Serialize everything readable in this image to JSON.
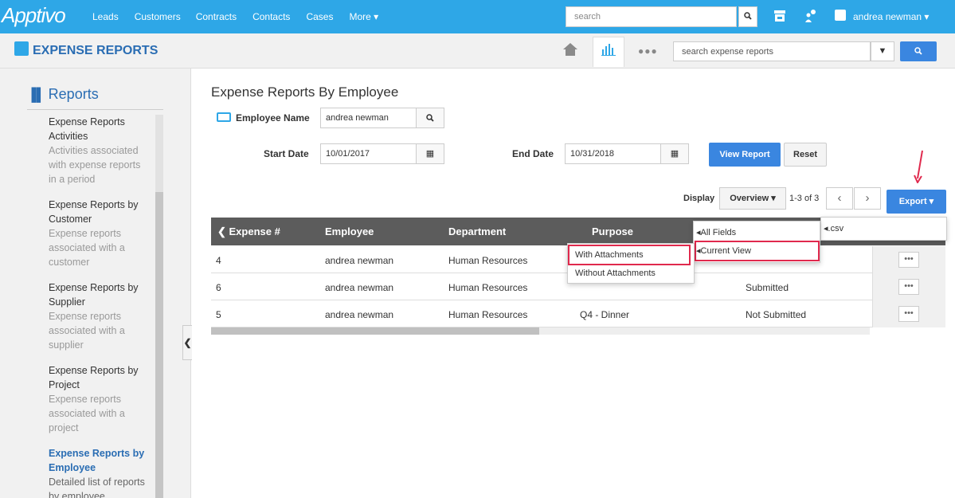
{
  "app": {
    "logo": "Apptivo",
    "nav": [
      "Leads",
      "Customers",
      "Contracts",
      "Contacts",
      "Cases",
      "More ▾"
    ],
    "search_placeholder": "search",
    "user": "andrea newman ▾"
  },
  "header": {
    "title": "EXPENSE REPORTS",
    "search_placeholder": "search expense reports"
  },
  "sidebar": {
    "title": "Reports",
    "items": [
      {
        "title": "Expense Reports Activities",
        "desc": "Activities associated with expense reports in a period",
        "active": false
      },
      {
        "title": "Expense Reports by Customer",
        "desc": "Expense reports associated with a customer",
        "active": false
      },
      {
        "title": "Expense Reports by Supplier",
        "desc": "Expense reports associated with a supplier",
        "active": false
      },
      {
        "title": "Expense Reports by Project",
        "desc": "Expense reports associated with a project",
        "active": false
      },
      {
        "title": "Expense Reports by Employee",
        "desc": "Detailed list of reports by employee",
        "active": true
      }
    ]
  },
  "report": {
    "title": "Expense Reports By Employee",
    "employee_label": "Employee Name",
    "employee_value": "andrea newman",
    "start_label": "Start Date",
    "start_value": "10/01/2017",
    "end_label": "End Date",
    "end_value": "10/31/2018",
    "view_btn": "View Report",
    "reset_btn": "Reset",
    "display_label": "Display",
    "display_value": "Overview ▾",
    "page_info": "1-3 of 3",
    "export_btn": "Export ▾"
  },
  "table": {
    "columns": [
      "Expense #",
      "Employee",
      "Department",
      "Purpose"
    ],
    "rows": [
      {
        "id": "4",
        "employee": "andrea newman",
        "department": "Human Resources",
        "purpose": "",
        "status": ""
      },
      {
        "id": "6",
        "employee": "andrea newman",
        "department": "Human Resources",
        "purpose": "",
        "status": "Submitted"
      },
      {
        "id": "5",
        "employee": "andrea newman",
        "department": "Human Resources",
        "purpose": "Q4 - Dinner",
        "status": "Not Submitted"
      }
    ]
  },
  "menus": {
    "export": [
      ".csv"
    ],
    "fields": [
      "All Fields",
      "Current View"
    ],
    "attachments": [
      "With Attachments",
      "Without Attachments"
    ]
  },
  "colors": {
    "topbar": "#2ea7e7",
    "primary_button": "#3a86e0",
    "highlight": "#e0294d"
  }
}
